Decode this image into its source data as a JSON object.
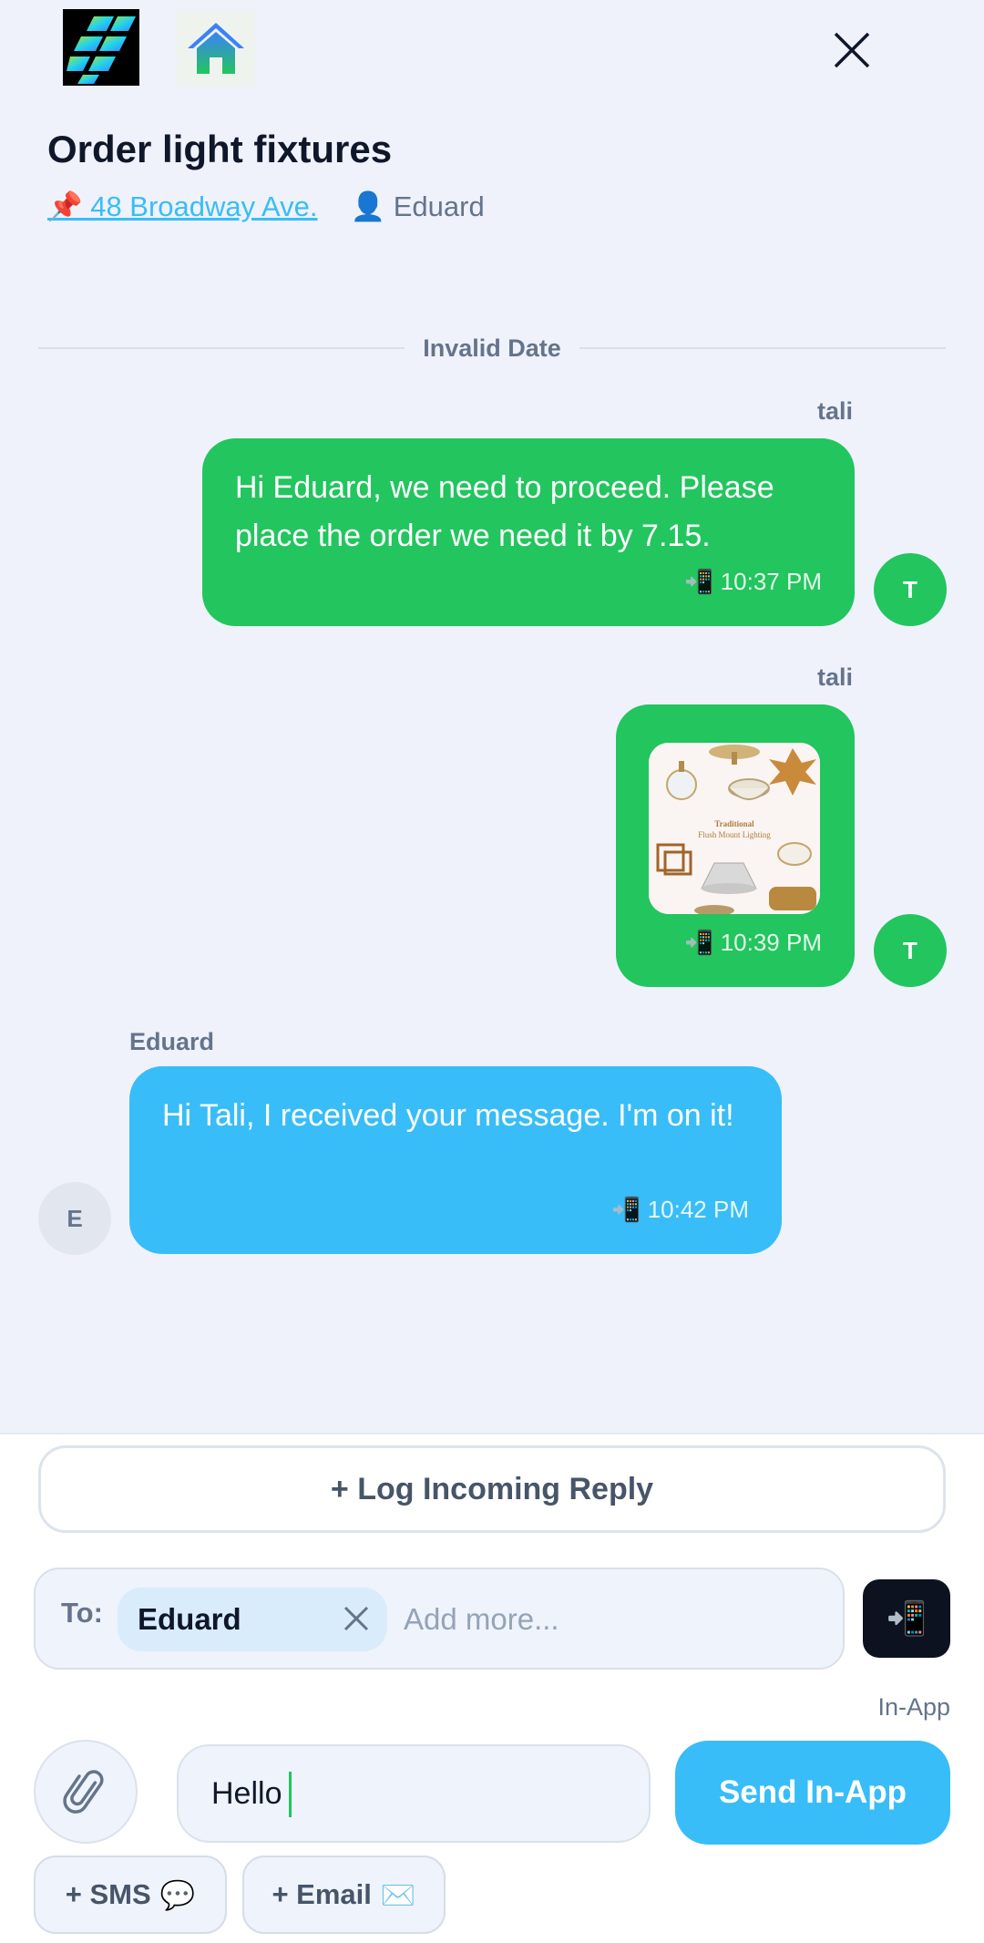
{
  "header": {
    "title": "Order light fixtures",
    "address": "📌 48 Broadway Ave.",
    "assignee": "👤 Eduard",
    "app_logo_icon": "lightning-tiles-logo",
    "home_icon": "home-icon",
    "close_icon": "close-icon"
  },
  "thread": {
    "date_separator": "Invalid Date",
    "messages": [
      {
        "sender": "tali",
        "text": "Hi Eduard, we need to proceed. Please place the order we need it by 7.15.",
        "time": "📲 10:37 PM",
        "avatar": "T"
      },
      {
        "sender": "tali",
        "image_caption": "Traditional Flush Mount Lighting",
        "time": "📲 10:39 PM",
        "avatar": "T"
      },
      {
        "sender": "Eduard",
        "text": "Hi Tali, I received your message. I'm on it!",
        "time": "📲 10:42 PM",
        "avatar": "E"
      }
    ]
  },
  "composer": {
    "log_reply_label": "+ Log Incoming Reply",
    "to_label": "To:",
    "recipient": "Eduard",
    "add_more_placeholder": "Add more...",
    "channel_icon": "📲",
    "channel_label": "In-App",
    "message_value": "Hello",
    "send_label": "Send In-App",
    "sms_label": "+ SMS",
    "sms_emoji": "💬",
    "email_label": "+ Email",
    "email_emoji": "✉️"
  },
  "colors": {
    "background": "#eff2fb",
    "sent_bubble": "#22c55e",
    "received_bubble": "#38bdf8",
    "accent": "#38bdf8"
  }
}
